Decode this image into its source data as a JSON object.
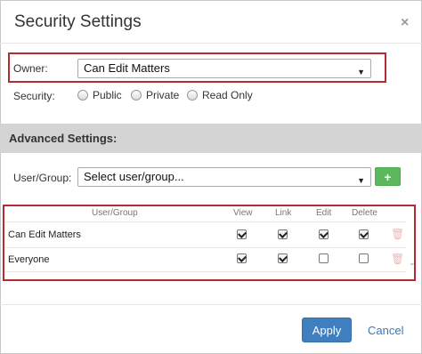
{
  "dialog": {
    "title": "Security Settings",
    "close_glyph": "×"
  },
  "owner": {
    "label": "Owner:",
    "value": "Can Edit Matters"
  },
  "security": {
    "label": "Security:",
    "options": [
      "Public",
      "Private",
      "Read Only"
    ],
    "selected": null
  },
  "advanced": {
    "title": "Advanced Settings:",
    "user_group_label": "User/Group:",
    "user_group_placeholder": "Select user/group...",
    "add_button": "+"
  },
  "table": {
    "headers": [
      "User/Group",
      "View",
      "Link",
      "Edit",
      "Delete"
    ],
    "rows": [
      {
        "name": "Can Edit Matters",
        "view": true,
        "link": true,
        "edit": true,
        "delete": true
      },
      {
        "name": "Everyone",
        "view": true,
        "link": true,
        "edit": false,
        "delete": false
      }
    ]
  },
  "footer": {
    "apply": "Apply",
    "cancel": "Cancel"
  },
  "icons": {
    "close": "close-icon",
    "caret": "chevron-down-icon",
    "add": "plus-icon",
    "delete": "trash-icon"
  },
  "colors": {
    "highlight_border": "#b52a34",
    "apply_button": "#3f7fbf",
    "add_button": "#5cb85c",
    "section_bar": "#d4d4d4"
  }
}
